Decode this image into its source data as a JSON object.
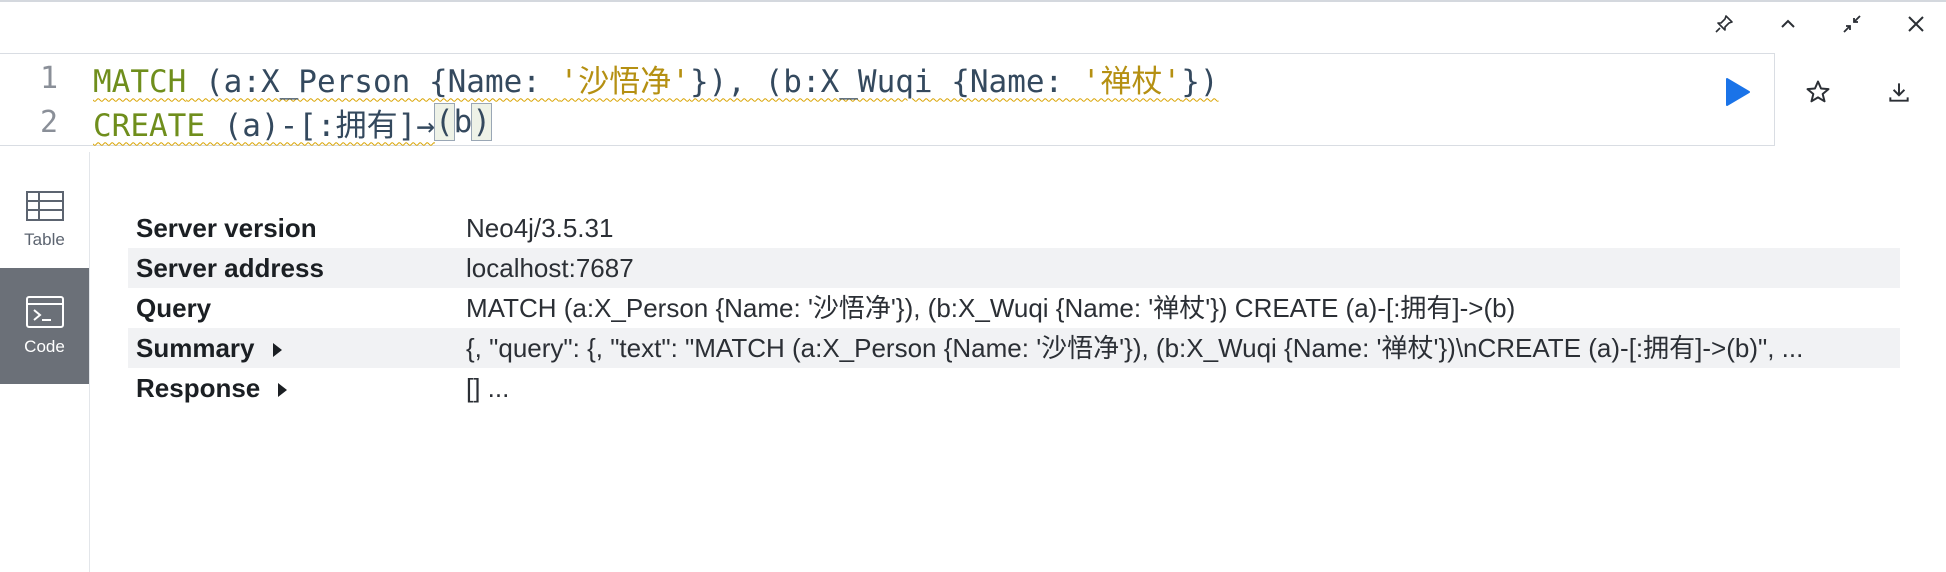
{
  "window_controls": {
    "pin_icon": "pin-icon",
    "collapse_icon": "chevron-up-icon",
    "restore_icon": "shrink-icon",
    "close_icon": "close-icon"
  },
  "editor": {
    "line1_no": "1",
    "line2_no": "2",
    "l1_kw": "MATCH",
    "l1_a": " (a:X_Person {Name: ",
    "l1_s1": "'沙悟净'",
    "l1_b": "}), (b:X_Wuqi {Name: ",
    "l1_s2": "'禅杖'",
    "l1_c": "})",
    "l2_kw": "CREATE",
    "l2_a": " (a)-[:拥有]→",
    "l2_open": "(",
    "l2_b": "b",
    "l2_close": ")",
    "run_icon": "play-icon",
    "favorite_icon": "star-icon",
    "download_icon": "download-icon"
  },
  "sidebar": {
    "table_label": "Table",
    "code_label": "Code"
  },
  "results": {
    "rows": [
      {
        "key": "Server version",
        "value": "Neo4j/3.5.31"
      },
      {
        "key": "Server address",
        "value": "localhost:7687"
      },
      {
        "key": "Query",
        "value": "MATCH (a:X_Person {Name: '沙悟净'}), (b:X_Wuqi {Name: '禅杖'}) CREATE (a)-[:拥有]->(b)"
      },
      {
        "key": "Summary",
        "value": "{, \"query\": {, \"text\": \"MATCH (a:X_Person {Name: '沙悟净'}), (b:X_Wuqi {Name: '禅杖'})\\nCREATE (a)-[:拥有]->(b)\", ..."
      },
      {
        "key": "Response",
        "value": "[] ..."
      }
    ]
  },
  "colors": {
    "accent": "#1a73e8",
    "keyword": "#6f8e1c",
    "string": "#b59012",
    "active_sidebar": "#6b7078"
  }
}
